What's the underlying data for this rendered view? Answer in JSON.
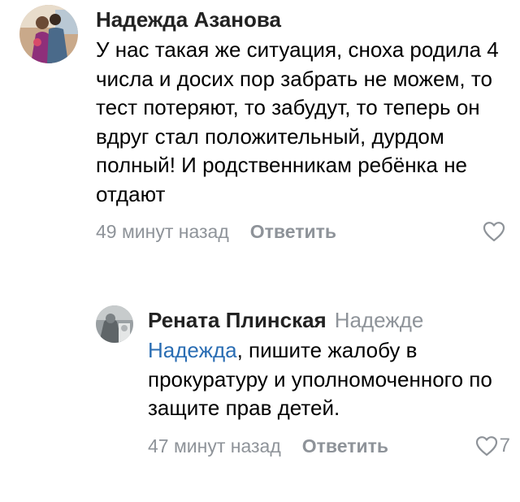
{
  "comments": [
    {
      "author": "Надежда Азанова",
      "text": "У нас такая же ситуация, сноха родила 4 числа и досих пор забрать не можем, то тест потеряют, то забудут, то теперь он вдруг стал положительный, дурдом полный! И родственникам ребёнка не отдают",
      "time": "49 минут назад",
      "reply_label": "Ответить",
      "likes": ""
    },
    {
      "author": "Рената Плинская",
      "reply_to": "Надежде",
      "mention": "Надежда",
      "text": ", пишите жалобу в прокуратуру и уполномоченного по защите прав детей.",
      "time": "47 минут назад",
      "reply_label": "Ответить",
      "likes": "7"
    }
  ],
  "colors": {
    "secondary": "#8e9399",
    "mention": "#2a6db3"
  },
  "icons": {
    "like": "heart-outline-icon"
  }
}
